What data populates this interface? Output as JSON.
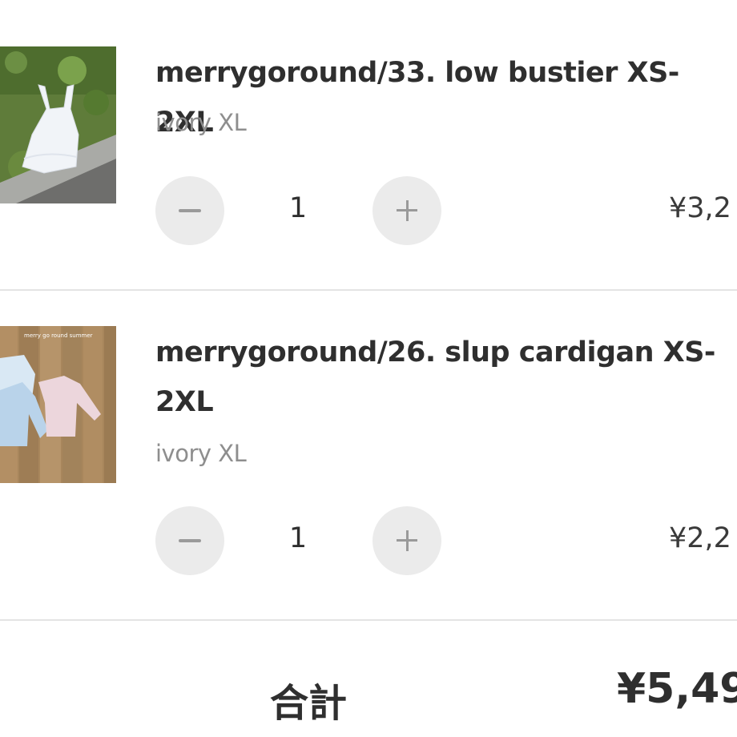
{
  "cart": {
    "items": [
      {
        "name": "merrygoround/33. low bustier XS-2XL",
        "variant": "ivory XL",
        "quantity": "1",
        "price": "¥3,2",
        "minus_symbol": "−",
        "plus_symbol": "+"
      },
      {
        "name_line1": "merrygoround/26. slup cardigan XS-",
        "name_line2": "2XL",
        "variant": "ivory XL",
        "quantity": "1",
        "price": "¥2,2",
        "photo_caption": "merry go round summer"
      }
    ],
    "total_label": "合計",
    "total_value": "¥5,49"
  }
}
